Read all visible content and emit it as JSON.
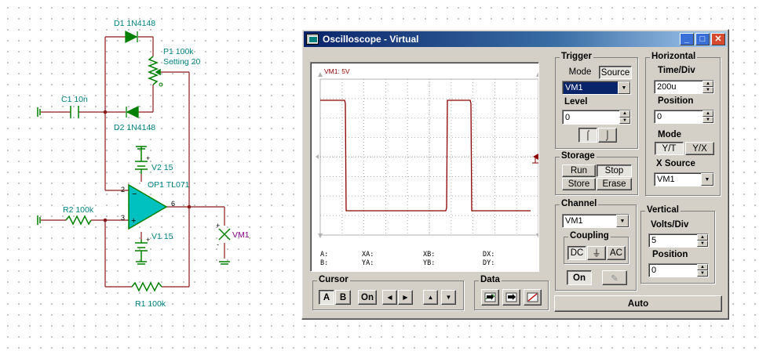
{
  "schematic": {
    "d1": "D1 1N4148",
    "p1_name": "P1 100k",
    "p1_setting": "Setting 20",
    "c1": "C1 10n",
    "d2": "D2 1N4148",
    "v2": "V2 15",
    "op1": "OP1 TL071",
    "r2": "R2 100k",
    "v1": "V1 15",
    "r1": "R1 100k",
    "vm1": "VM1",
    "pin2": "2",
    "pin3": "3",
    "pin6": "6",
    "plus": "+",
    "minus": "-"
  },
  "window": {
    "title": "Oscilloscope - Virtual",
    "minimize": "_",
    "maximize": "□",
    "close": "✕"
  },
  "display": {
    "channel_label": "VM1: 5V",
    "trace_color": "#8b0000",
    "cursor_readout": {
      "a": "A:",
      "b": "B:",
      "xa": "XA:",
      "ya": "YA:",
      "xb": "XB:",
      "yb": "YB:",
      "dx": "DX:",
      "dy": "DY:"
    }
  },
  "trigger": {
    "title": "Trigger",
    "mode_btn": "Mode",
    "source_btn": "Source",
    "source_value": "VM1",
    "level_label": "Level",
    "level_value": "0",
    "rising_icon": "rising-edge-icon",
    "falling_icon": "falling-edge-icon"
  },
  "horizontal": {
    "title": "Horizontal",
    "timediv_label": "Time/Div",
    "timediv_value": "200u",
    "position_label": "Position",
    "position_value": "0",
    "mode_label": "Mode",
    "yt": "Y/T",
    "yx": "Y/X",
    "xsource_label": "X Source",
    "xsource_value": "VM1"
  },
  "storage": {
    "title": "Storage",
    "run": "Run",
    "stop": "Stop",
    "store": "Store",
    "erase": "Erase"
  },
  "channel": {
    "title": "Channel",
    "value": "VM1",
    "coupling_title": "Coupling",
    "dc": "DC",
    "gnd": "⏚",
    "ac": "AC",
    "on": "On"
  },
  "vertical": {
    "title": "Vertical",
    "voltsdiv_label": "Volts/Div",
    "voltsdiv_value": "5",
    "position_label": "Position",
    "position_value": "0"
  },
  "cursor": {
    "title": "Cursor",
    "a": "A",
    "b": "B",
    "on": "On",
    "left": "◀",
    "right": "▶",
    "up": "▲",
    "down": "▼"
  },
  "data": {
    "title": "Data"
  },
  "auto": "Auto"
}
